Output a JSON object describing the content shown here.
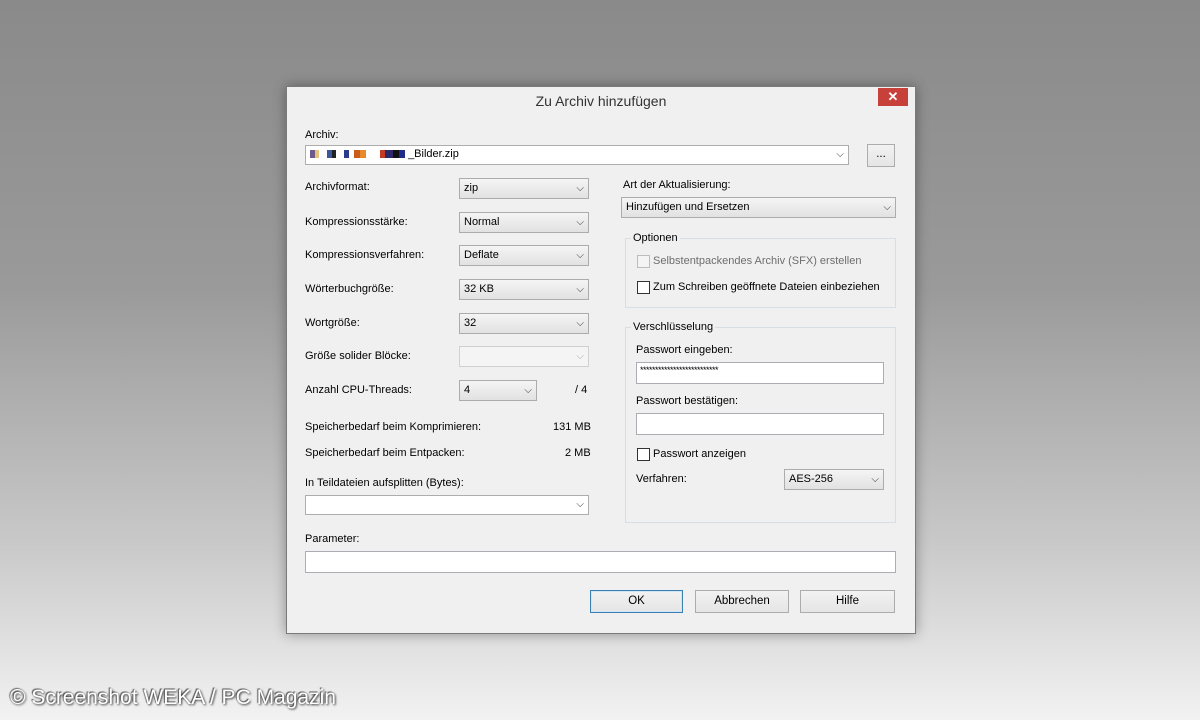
{
  "window": {
    "title": "Zu Archiv hinzufügen",
    "close_label": "✕"
  },
  "archive": {
    "label": "Archiv:",
    "filename_suffix": "_Bilder.zip",
    "browse_label": "..."
  },
  "left": {
    "format": {
      "label": "Archivformat:",
      "value": "zip"
    },
    "level": {
      "label": "Kompressionsstärke:",
      "value": "Normal"
    },
    "method": {
      "label": "Kompressionsverfahren:",
      "value": "Deflate"
    },
    "dict": {
      "label": "Wörterbuchgröße:",
      "value": "32 KB"
    },
    "word": {
      "label": "Wortgröße:",
      "value": "32"
    },
    "solid": {
      "label": "Größe solider Blöcke:",
      "value": ""
    },
    "threads": {
      "label": "Anzahl CPU-Threads:",
      "value": "4",
      "max": "/ 4"
    },
    "mem_compress": {
      "label": "Speicherbedarf beim Komprimieren:",
      "value": "131 MB"
    },
    "mem_decompress": {
      "label": "Speicherbedarf beim Entpacken:",
      "value": "2 MB"
    },
    "split": {
      "label": "In Teildateien aufsplitten (Bytes):",
      "value": ""
    }
  },
  "parameter": {
    "label": "Parameter:",
    "value": ""
  },
  "right": {
    "update_mode": {
      "label": "Art der Aktualisierung:",
      "value": "Hinzufügen und Ersetzen"
    },
    "options": {
      "legend": "Optionen",
      "sfx": {
        "label": "Selbstentpackendes Archiv (SFX) erstellen",
        "checked": false
      },
      "shared": {
        "label": "Zum Schreiben geöffnete Dateien einbeziehen",
        "checked": false
      }
    },
    "encryption": {
      "legend": "Verschlüsselung",
      "password_label": "Passwort eingeben:",
      "password_value": "**************************",
      "confirm_label": "Passwort bestätigen:",
      "confirm_value": "",
      "show_label": "Passwort anzeigen",
      "method_label": "Verfahren:",
      "method_value": "AES-256"
    }
  },
  "buttons": {
    "ok": "OK",
    "cancel": "Abbrechen",
    "help": "Hilfe"
  },
  "watermark": "© Screenshot WEKA / PC Magazin",
  "colors": {
    "close": "#c7403a",
    "default_button_border": "#3c7fb1"
  }
}
